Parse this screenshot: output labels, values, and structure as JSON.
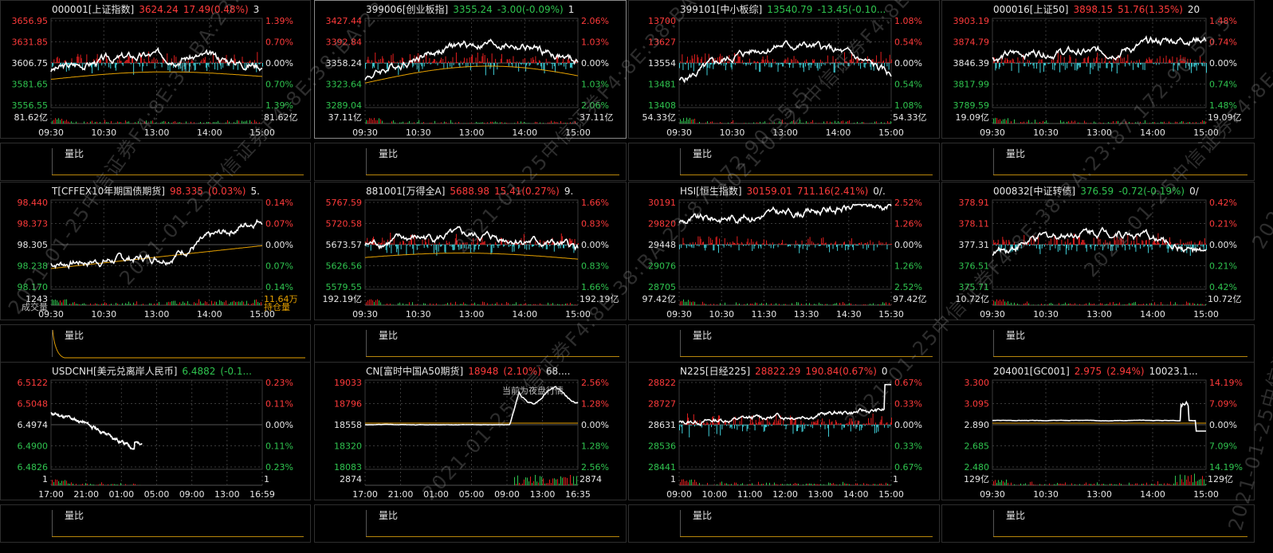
{
  "colors": {
    "up": "#ff3b3b",
    "down": "#2fc44f",
    "price": "#ffffff",
    "avg": "#e6a100",
    "bar_up": "#e01e1e",
    "bar_dn": "#3fcfd8",
    "grid": "#3a3a3a"
  },
  "watermark": "2021-01-25中信证券F4:8E:38:BA:23:87,172.90.55.5",
  "mini_label": "量比",
  "panels": [
    {
      "code": "000001[上证指数]",
      "price": "3624.24",
      "change": "17.49(0.48%)",
      "amount": "3",
      "dir": "up",
      "y_left": [
        "3656.95",
        "3631.85",
        "3606.75",
        "3581.65",
        "3556.55"
      ],
      "y_right": [
        "1.39%",
        "0.70%",
        "0.00%",
        "0.70%",
        "1.39%"
      ],
      "vol_left": "81.62亿",
      "vol_right": "81.62亿",
      "x_ticks": [
        "09:30",
        "10:30",
        "13:00",
        "14:00",
        "15:00"
      ]
    },
    {
      "code": "399006[创业板指]",
      "price": "3355.24",
      "change": "-3.00(-0.09%)",
      "amount": "1",
      "dir": "dn",
      "y_left": [
        "3427.44",
        "3392.84",
        "3358.24",
        "3323.64",
        "3289.04"
      ],
      "y_right": [
        "2.06%",
        "1.03%",
        "0.00%",
        "1.03%",
        "2.06%"
      ],
      "vol_left": "37.11亿",
      "vol_right": "37.11亿",
      "x_ticks": [
        "09:30",
        "10:30",
        "13:00",
        "14:00",
        "15:00"
      ]
    },
    {
      "code": "399101[中小板综]",
      "price": "13540.79",
      "change": "-13.45(-0.10...",
      "amount": "",
      "dir": "dn",
      "y_left": [
        "13700",
        "13627",
        "13554",
        "13481",
        "13408"
      ],
      "y_right": [
        "1.08%",
        "0.54%",
        "0.00%",
        "0.54%",
        "1.08%"
      ],
      "vol_left": "54.33亿",
      "vol_right": "54.33亿",
      "x_ticks": [
        "09:30",
        "10:30",
        "13:00",
        "14:00",
        "15:00"
      ]
    },
    {
      "code": "000016[上证50]",
      "price": "3898.15",
      "change": "51.76(1.35%)",
      "amount": "20",
      "dir": "up",
      "y_left": [
        "3903.19",
        "3874.79",
        "3846.39",
        "3817.99",
        "3789.59"
      ],
      "y_right": [
        "1.48%",
        "0.74%",
        "0.00%",
        "0.74%",
        "1.48%"
      ],
      "vol_left": "19.09亿",
      "vol_right": "19.09亿",
      "x_ticks": [
        "09:30",
        "10:30",
        "13:00",
        "14:00",
        "15:00"
      ]
    },
    {
      "code": "T[CFFEX10年期国债期货]",
      "price": "98.335",
      "change": "(0.03%)",
      "amount": "5.",
      "dir": "up",
      "y_left": [
        "98.440",
        "98.373",
        "98.305",
        "98.238",
        "98.170"
      ],
      "y_right": [
        "0.14%",
        "0.07%",
        "0.00%",
        "0.07%",
        "0.14%"
      ],
      "vol_left": "1243",
      "vol_right": "11.64万",
      "vol_left2": "成交量",
      "vol_right2": "持仓量",
      "x_ticks": [
        "09:30",
        "10:30",
        "13:00",
        "14:00",
        "15:00"
      ]
    },
    {
      "code": "881001[万得全A]",
      "price": "5688.98",
      "change": "15.41(0.27%)",
      "amount": "9.",
      "dir": "up",
      "y_left": [
        "5767.59",
        "5720.58",
        "5673.57",
        "5626.56",
        "5579.55"
      ],
      "y_right": [
        "1.66%",
        "0.83%",
        "0.00%",
        "0.83%",
        "1.66%"
      ],
      "vol_left": "192.19亿",
      "vol_right": "192.19亿",
      "x_ticks": [
        "09:30",
        "10:30",
        "13:00",
        "14:00",
        "15:00"
      ]
    },
    {
      "code": "HSI[恒生指数]",
      "price": "30159.01",
      "change": "711.16(2.41%)",
      "amount": "0/.",
      "dir": "up",
      "y_left": [
        "30191",
        "29820",
        "29448",
        "29076",
        "28705"
      ],
      "y_right": [
        "2.52%",
        "1.26%",
        "0.00%",
        "1.26%",
        "2.52%"
      ],
      "vol_left": "97.42亿",
      "vol_right": "97.42亿",
      "x_ticks": [
        "09:30",
        "10:30",
        "11:30",
        "13:30",
        "14:30",
        "15:30"
      ]
    },
    {
      "code": "000832[中证转债]",
      "price": "376.59",
      "change": "-0.72(-0.19%)",
      "amount": "0/",
      "dir": "dn",
      "y_left": [
        "378.91",
        "378.11",
        "377.31",
        "376.51",
        "375.71"
      ],
      "y_right": [
        "0.42%",
        "0.21%",
        "0.00%",
        "0.21%",
        "0.42%"
      ],
      "vol_left": "10.72亿",
      "vol_right": "10.72亿",
      "x_ticks": [
        "09:30",
        "10:30",
        "13:00",
        "14:00",
        "15:00"
      ]
    },
    {
      "code": "USDCNH[美元兑离岸人民币]",
      "price": "6.4882",
      "change": "(-0.1...",
      "amount": "",
      "dir": "dn",
      "y_left": [
        "6.5122",
        "6.5048",
        "6.4974",
        "6.4900",
        "6.4826"
      ],
      "y_right": [
        "0.23%",
        "0.11%",
        "0.00%",
        "0.11%",
        "0.23%"
      ],
      "vol_left": "1",
      "vol_right": "1",
      "x_ticks": [
        "17:00",
        "21:00",
        "01:00",
        "05:00",
        "09:00",
        "13:00",
        "16:59"
      ]
    },
    {
      "code": "CN[富时中国A50期货]",
      "price": "18948",
      "change": "(2.10%)",
      "amount": "68....",
      "dir": "up",
      "y_left": [
        "19033",
        "18796",
        "18558",
        "18320",
        "18083"
      ],
      "y_right": [
        "2.56%",
        "1.28%",
        "0.00%",
        "1.28%",
        "2.56%"
      ],
      "vol_left": "2874",
      "vol_right": "2874",
      "note": "当前为夜盘行情",
      "x_ticks": [
        "17:00",
        "21:00",
        "01:00",
        "05:00",
        "09:00",
        "13:00",
        "16:35"
      ]
    },
    {
      "code": "N225[日经225]",
      "price": "28822.29",
      "change": "190.84(0.67%)",
      "amount": "0",
      "dir": "up",
      "y_left": [
        "28822",
        "28727",
        "28631",
        "28536",
        "28441"
      ],
      "y_right": [
        "0.67%",
        "0.33%",
        "0.00%",
        "0.33%",
        "0.67%"
      ],
      "vol_left": "1",
      "vol_right": "1",
      "x_ticks": [
        "09:00",
        "10:00",
        "11:00",
        "12:00",
        "13:00",
        "14:00",
        "15:00"
      ]
    },
    {
      "code": "204001[GC001]",
      "price": "2.975",
      "change": "(2.94%)",
      "amount": "10023.1...",
      "dir": "up",
      "y_left": [
        "3.300",
        "3.095",
        "2.890",
        "2.685",
        "2.480"
      ],
      "y_right": [
        "14.19%",
        "7.09%",
        "0.00%",
        "7.09%",
        "14.19%"
      ],
      "vol_left": "129亿",
      "vol_right": "129亿",
      "x_ticks": [
        "09:30",
        "10:30",
        "13:00",
        "14:00",
        "15:00"
      ]
    }
  ]
}
